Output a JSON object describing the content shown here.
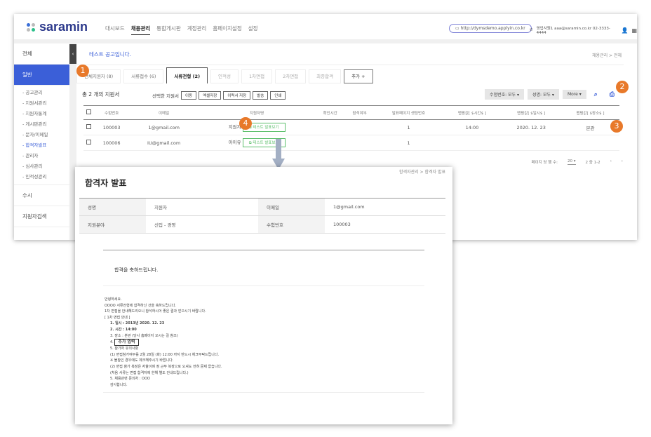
{
  "header": {
    "logo": "saramin",
    "nav": [
      "대시보드",
      "채용관리",
      "통합게시판",
      "계정관리",
      "홈페이지설정",
      "설정"
    ],
    "active_nav": "채용관리",
    "url": "http://dymsdemo.applyin.co.kr",
    "contact": "영업사원1 aaa@saramin.co.kr 02-3333-4444"
  },
  "sidebar": {
    "items": [
      "전체",
      "일반"
    ],
    "sub": [
      "- 공고관리",
      "- 지원서관리",
      "- 지원자통계",
      "- 게시판관리",
      "- 문자/이메일",
      "- 합격자발표",
      "- 관리자",
      "- 심사관리",
      "- 인적성관리"
    ],
    "bottom": [
      "수시",
      "지원자검색"
    ],
    "toggle": "‹"
  },
  "main": {
    "job_title": "테스트 공고입니다.",
    "breadcrumb": "채용관리  >  전체",
    "tabs": [
      "전체지원자 (8)",
      "서류접수 (6)",
      "서류전형 (2)",
      "인적성",
      "1차면접",
      "2차면접",
      "최종합격",
      "추가  +"
    ],
    "count": "총 2 개의 지원서",
    "selected_label": "선택한 지원서",
    "actions": [
      "이동",
      "엑셀저장",
      "이력서 저장",
      "발송",
      "인쇄"
    ],
    "filters": [
      "수험번호: 모두 ▾",
      "성명: 모두 ▾",
      "More ▾"
    ],
    "columns": [
      "",
      "수험번호",
      "이메일",
      "지원자명",
      "확인시간",
      "참석여부",
      "발표페이지 셋팅번호",
      "맵핑값[ $시간$ ]",
      "맵핑값[ $일시$ ]",
      "맵핑값[ $장소$ ]"
    ],
    "rows": [
      {
        "id": "100003",
        "email": "1@gmail.com",
        "name": "지원자",
        "view": "테스트 발표보기",
        "setting": "1",
        "time": "14:00",
        "date": "2020. 12. 23",
        "place": "본관"
      },
      {
        "id": "100006",
        "email": "IU@gmail.com",
        "name": "아이유",
        "view": "테스트 발표보기",
        "setting": "1",
        "time": "",
        "date": "",
        "place": ""
      }
    ],
    "pagination": {
      "per_page_label": "페이지 당 행 수:",
      "per_page": "20 ▾",
      "range": "2 중 1-2",
      "prev": "‹",
      "next": "›"
    }
  },
  "popup": {
    "title": "합격자 발표",
    "breadcrumb": "합격자관리  >  합격자 발표",
    "info": [
      [
        "성명",
        "지원자",
        "이메일",
        "1@gmail.com"
      ],
      [
        "지원분야",
        "신입 - 경영",
        "수험번호",
        "100003"
      ]
    ],
    "congrats": "합격을 축하드립니다.",
    "letter": [
      "안녕하세요.",
      "OOOO 서류전형에 합격하신 것을 축하드립니다.",
      "1차 면접을 안내해드리오니 참석하시어 좋은 결과 얻으시기 바랍니다.",
      "[ 1차 면접 안내 ]"
    ],
    "items": [
      "1. 일시 : 2013년  2020. 12. 23",
      "2. 시간 :  14:00",
      "3. 장소 :   본관 (당사 홈페이지 오시는 길 참조)",
      "4.",
      "5. 참가자 유의사항",
      "(1) 면접참가여부를 2월 28일 (화) 12:00 까지 반드시 체크부탁드립니다.",
      "※ 불참인 경우에도 체크해주시기 바랍니다.",
      "(2) 면접 참가 복장은 자율이며 정 근무 복장으로 오셔도 전혀 문제 없습니다.",
      "(처음 서류는 면접 합격자에 한해 별도 안내드립니다.)",
      "5. 채용관련 문의처 : OOO",
      "감사합니다."
    ],
    "add_button": "추가 입력"
  },
  "badges": [
    "1",
    "2",
    "3",
    "4"
  ],
  "colors": {
    "accent": "#3b5fd8",
    "badge": "#e8792a",
    "view_button": "#5cbf6b"
  }
}
